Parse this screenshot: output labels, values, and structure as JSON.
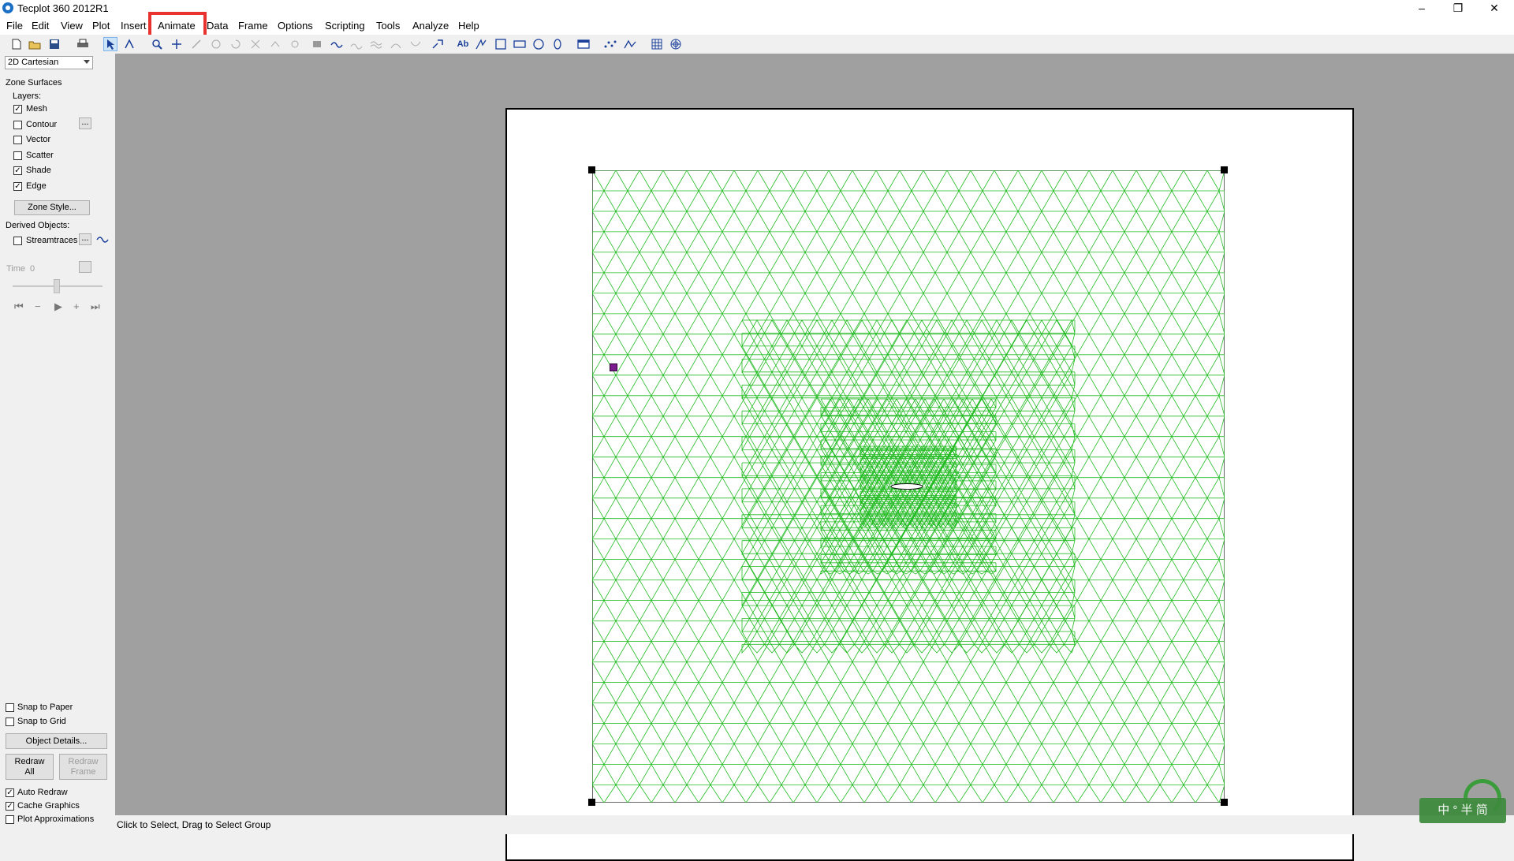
{
  "window": {
    "title": "Tecplot 360 2012R1"
  },
  "menu": [
    "File",
    "Edit",
    "View",
    "Plot",
    "Insert",
    "Animate",
    "Data",
    "Frame",
    "Options",
    "Scripting",
    "Tools",
    "Analyze",
    "Help"
  ],
  "left_panel": {
    "plot_type": "2D Cartesian",
    "zone_surfaces": "Zone Surfaces",
    "layers_label": "Layers:",
    "layers": [
      {
        "label": "Mesh",
        "checked": true
      },
      {
        "label": "Contour",
        "checked": false
      },
      {
        "label": "Vector",
        "checked": false
      },
      {
        "label": "Scatter",
        "checked": false
      },
      {
        "label": "Shade",
        "checked": true
      },
      {
        "label": "Edge",
        "checked": true
      }
    ],
    "zone_style_button": "Zone Style...",
    "derived_objects": "Derived Objects:",
    "streamtraces": "Streamtraces",
    "ellipsis": "...",
    "time_label": "Time",
    "time_value": "0",
    "snap_to_paper": "Snap to Paper",
    "snap_to_grid": "Snap to Grid",
    "object_details": "Object Details...",
    "redraw_all_1": "Redraw",
    "redraw_all_2": "All",
    "redraw_frame_1": "Redraw",
    "redraw_frame_2": "Frame",
    "auto_redraw": "Auto Redraw",
    "cache_graphics": "Cache Graphics",
    "plot_approximations": "Plot Approximations"
  },
  "status": {
    "text": "Click to Select, Drag to Select Group"
  },
  "ime": {
    "text": "中 ° 半 简"
  },
  "colors": {
    "mesh": "#22bb22",
    "highlight": "#e8322f"
  }
}
